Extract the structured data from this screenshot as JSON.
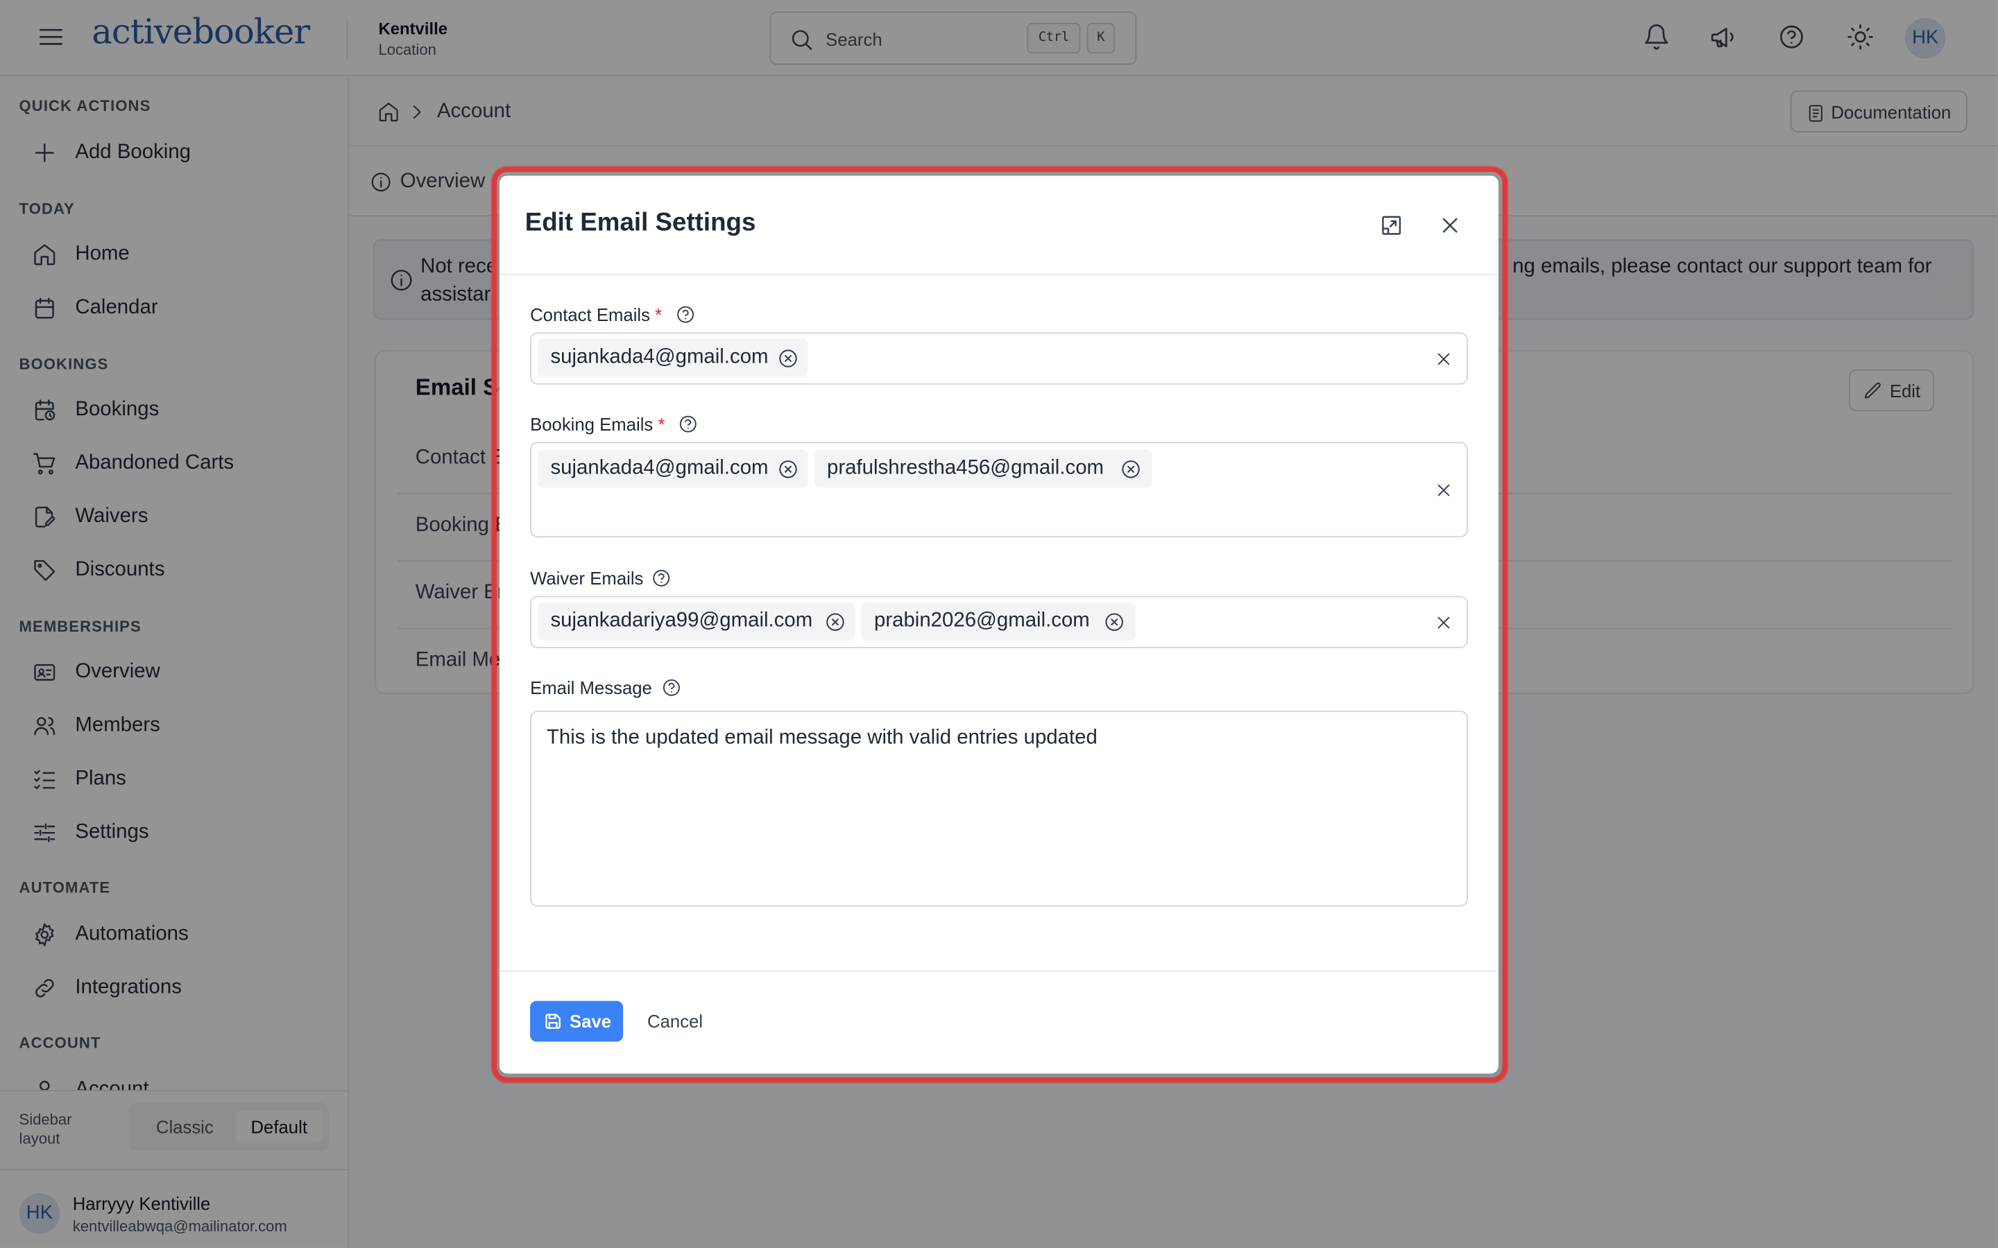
{
  "header": {
    "logo": "activebooker",
    "location_name": "Kentville",
    "location_label": "Location",
    "search_placeholder": "Search",
    "shortcut_key1": "Ctrl",
    "shortcut_key2": "K",
    "avatar_initials": "HK"
  },
  "sidebar": {
    "sections": {
      "quick_actions": "QUICK ACTIONS",
      "today": "TODAY",
      "bookings": "BOOKINGS",
      "memberships": "MEMBERSHIPS",
      "automate": "AUTOMATE",
      "account": "ACCOUNT"
    },
    "items": {
      "add_booking": "Add Booking",
      "home": "Home",
      "calendar": "Calendar",
      "bookings": "Bookings",
      "abandoned_carts": "Abandoned Carts",
      "waivers": "Waivers",
      "discounts": "Discounts",
      "overview": "Overview",
      "members": "Members",
      "plans": "Plans",
      "settings": "Settings",
      "automations": "Automations",
      "integrations": "Integrations",
      "account": "Account"
    },
    "layout_label": "Sidebar layout",
    "layout_options": [
      "Classic",
      "Default"
    ],
    "user": {
      "initials": "HK",
      "name": "Harryyy Kentiville",
      "email": "kentvilleabwqa@mailinator.com"
    }
  },
  "main": {
    "breadcrumb_current": "Account",
    "documentation_label": "Documentation",
    "tab_overview": "Overview",
    "notice_line1": "Not rece",
    "notice_line2": "assistar",
    "notice_right": "ng emails, please contact our support team for",
    "card_title": "Email Se",
    "card_rows": [
      "Contact E",
      "Booking E",
      "Waiver Er",
      "Email Me"
    ],
    "edit_label": "Edit"
  },
  "modal": {
    "title": "Edit Email Settings",
    "contact_label": "Contact Emails",
    "booking_label": "Booking Emails",
    "waiver_label": "Waiver Emails",
    "message_label": "Email Message",
    "required_mark": "*",
    "contact_emails": [
      "sujankada4@gmail.com"
    ],
    "booking_emails": [
      "sujankada4@gmail.com",
      "prafulshrestha456@gmail.com"
    ],
    "waiver_emails": [
      "sujankadariya99@gmail.com",
      "prabin2026@gmail.com"
    ],
    "message_value": "This is the updated email message with valid entries updated",
    "save_label": "Save",
    "cancel_label": "Cancel",
    "highlight_color": "#dd3b3b",
    "primary_color": "#3b82f6"
  }
}
